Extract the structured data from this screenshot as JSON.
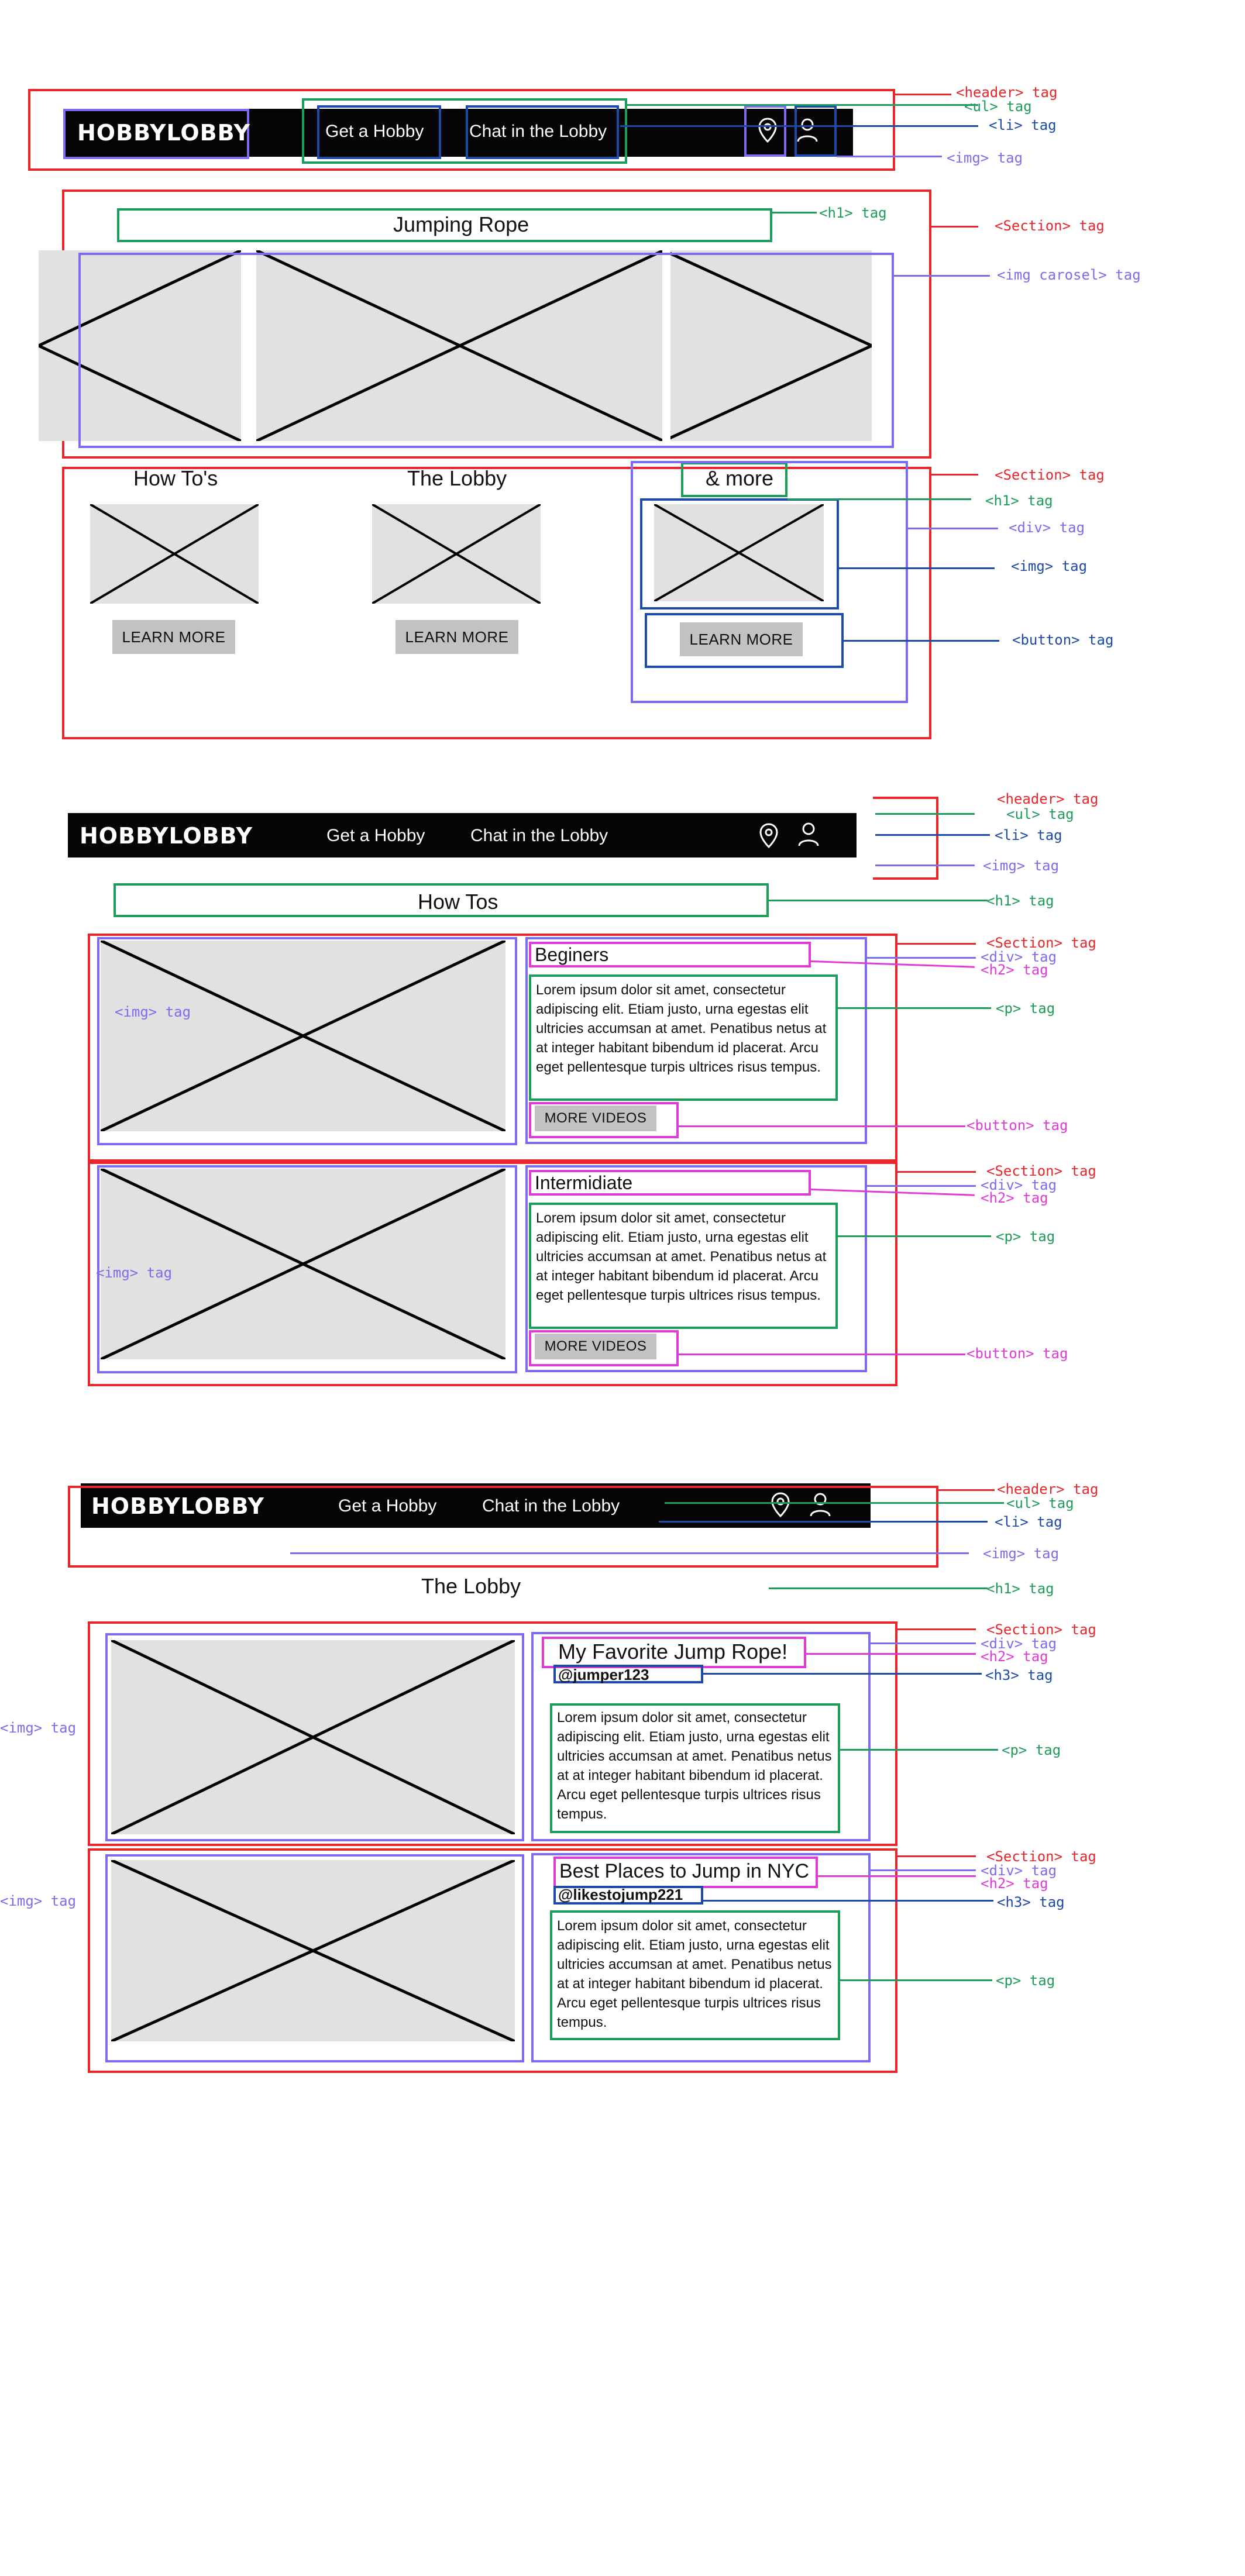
{
  "colors": {
    "header": "#e8262b",
    "list": "#1e9c5a",
    "list_item": "#1d4aa8",
    "image": "#7b6cf0",
    "subheading": "#e03bd6",
    "placeholder": "#e1e1e1",
    "navbar": "#050505"
  },
  "nav": {
    "logo": "HOBBYLOBBY",
    "links": [
      "Get a Hobby",
      "Chat in the Lobby"
    ],
    "icons": [
      "location-pin-icon",
      "user-icon"
    ]
  },
  "tags": {
    "header": "<header> tag",
    "ul": "<ul> tag",
    "li": "<li> tag",
    "img": "<img> tag",
    "h1": "<h1> tag",
    "section": "<Section> tag",
    "img_carousel": "<img carosel> tag",
    "div": "<div> tag",
    "button": "<button> tag",
    "h2": "<h2> tag",
    "p": "<p> tag",
    "h3": "<h3> tag"
  },
  "wireframe1": {
    "hero_title": "Jumping Rope",
    "cards": [
      {
        "title": "How To's",
        "button": "LEARN MORE"
      },
      {
        "title": "The Lobby",
        "button": "LEARN MORE"
      },
      {
        "title": "& more",
        "button": "LEARN MORE"
      }
    ]
  },
  "wireframe2": {
    "page_title": "How Tos",
    "sections": [
      {
        "heading": "Beginers",
        "text": "Lorem ipsum dolor sit amet, consectetur adipiscing elit. Etiam justo, urna egestas elit ultricies accumsan at amet. Penatibus netus at at integer habitant bibendum id placerat. Arcu eget pellentesque turpis ultrices risus tempus.",
        "button": "MORE VIDEOS"
      },
      {
        "heading": "Intermidiate",
        "text": "Lorem ipsum dolor sit amet, consectetur adipiscing elit. Etiam justo, urna egestas elit ultricies accumsan at amet. Penatibus netus at at integer habitant bibendum id placerat. Arcu eget pellentesque turpis ultrices risus tempus.",
        "button": "MORE VIDEOS"
      }
    ]
  },
  "wireframe3": {
    "page_title": "The Lobby",
    "posts": [
      {
        "heading": "My Favorite Jump Rope!",
        "handle": "@jumper123",
        "text": "Lorem ipsum dolor sit amet, consectetur adipiscing elit. Etiam justo, urna egestas elit ultricies accumsan at amet. Penatibus netus at at integer habitant bibendum id placerat. Arcu eget pellentesque turpis ultrices risus tempus."
      },
      {
        "heading": "Best Places to Jump in NYC",
        "handle": "@likestojump221",
        "text": "Lorem ipsum dolor sit amet, consectetur adipiscing elit. Etiam justo, urna egestas elit ultricies accumsan at amet. Penatibus netus at at integer habitant bibendum id placerat. Arcu eget pellentesque turpis ultrices risus tempus."
      }
    ]
  }
}
